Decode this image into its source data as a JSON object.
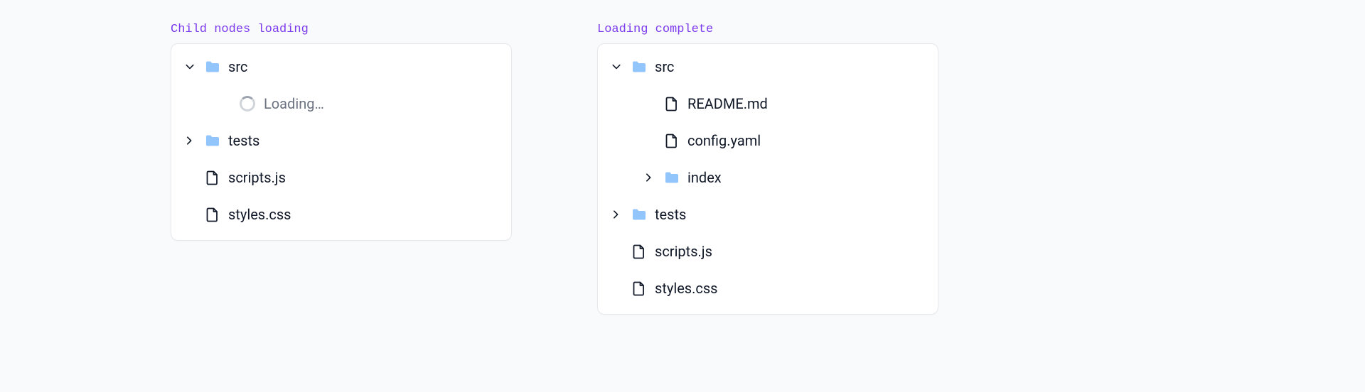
{
  "sections": [
    {
      "title": "Child nodes loading"
    },
    {
      "title": "Loading complete"
    }
  ],
  "loading_label": "Loading…",
  "nodes": {
    "src": "src",
    "tests": "tests",
    "scripts_js": "scripts.js",
    "styles_css": "styles.css",
    "readme_md": "README.md",
    "config_yaml": "config.yaml",
    "index": "index"
  },
  "colors": {
    "folder": "#93c5fd",
    "accent": "#7c3aed"
  }
}
